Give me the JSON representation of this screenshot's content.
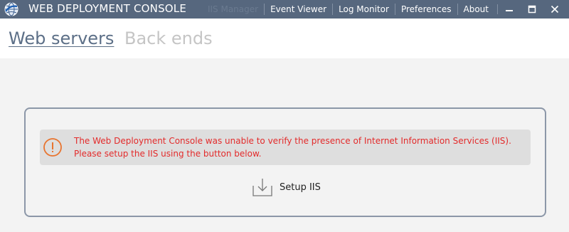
{
  "app": {
    "title": "WEB DEPLOYMENT CONSOLE",
    "icon": "globe-logo-icon"
  },
  "menu": {
    "items": [
      {
        "label": "IIS Manager",
        "state": "disabled"
      },
      {
        "label": "Event Viewer"
      },
      {
        "label": "Log Monitor"
      },
      {
        "label": "Preferences"
      },
      {
        "label": "About"
      }
    ]
  },
  "window_controls": {
    "minimize": "minimize-icon",
    "maximize": "maximize-icon",
    "close": "close-icon"
  },
  "tabs": [
    {
      "label": "Web servers",
      "selected": true
    },
    {
      "label": "Back ends",
      "selected": false
    }
  ],
  "warning": {
    "icon": "exclamation-circle-icon",
    "message": "The Web Deployment Console was unable to verify the presence of Internet Information Services (IIS). Please setup the IIS using the button below."
  },
  "setup_button": {
    "label": "Setup IIS",
    "icon": "download-tray-icon"
  },
  "colors": {
    "titlebar": "#56677e",
    "selected_tab": "#5c6f87",
    "inactive_tab": "#c5c5c5",
    "warning_text": "#e32b2b",
    "warning_icon": "#e8742f",
    "panel_border": "#8c97a8"
  }
}
